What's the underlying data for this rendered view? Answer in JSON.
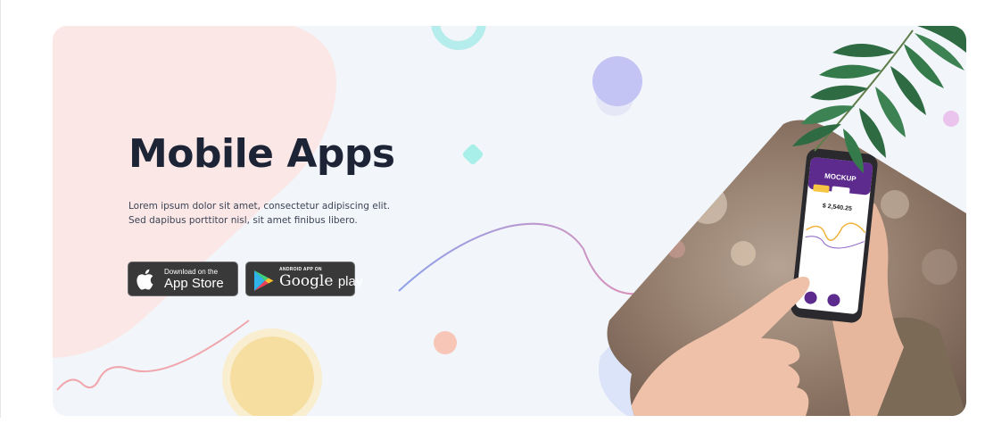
{
  "hero": {
    "title": "Mobile Apps",
    "description_line1": "Lorem ipsum dolor sit amet, consectetur adipiscing elit.",
    "description_line2": "Sed dapibus porttitor nisl, sit amet finibus libero."
  },
  "app_store_button": {
    "small_text": "Download on the",
    "big_text": "App Store",
    "icon": "apple-icon"
  },
  "google_play_button": {
    "small_text": "ANDROID APP ON",
    "brand_text": "Google",
    "big_text": "play",
    "icon": "google-play-icon"
  },
  "phone_screen": {
    "app_name": "MOCKUP",
    "balance": "$ 2,540.25"
  },
  "colors": {
    "title": "#1c2436",
    "hero_background": "#f2f5f9",
    "pink_blob": "#fbe7e6",
    "button_background": "#393939"
  }
}
